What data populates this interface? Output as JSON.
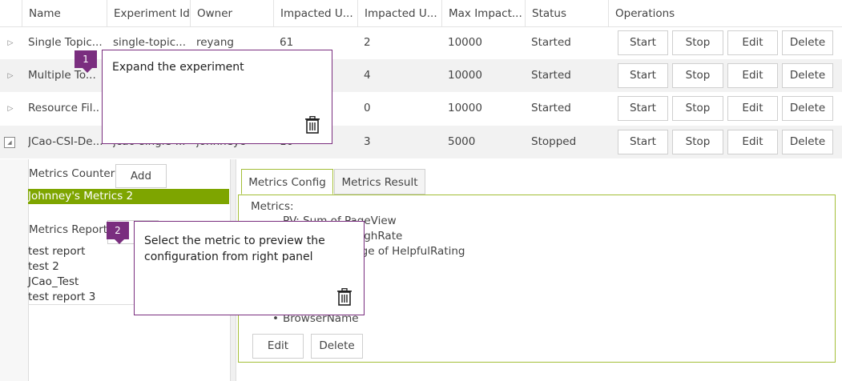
{
  "table": {
    "headers": [
      "Name",
      "Experiment Id",
      "Owner",
      "Impacted U...",
      "Impacted U...",
      "Max Impact...",
      "Status",
      "Operations"
    ],
    "rows": [
      {
        "name": "Single Topic...",
        "id": "single-topic...",
        "owner": "reyang",
        "u1": "61",
        "u2": "2",
        "max": "10000",
        "status": "Started"
      },
      {
        "name": "Multiple To...",
        "id": "",
        "owner": "",
        "u1": "",
        "u2": "4",
        "max": "10000",
        "status": "Started"
      },
      {
        "name": "Resource Fil...",
        "id": "",
        "owner": "",
        "u1": "",
        "u2": "0",
        "max": "10000",
        "status": "Started"
      },
      {
        "name": "JCao-CSI-De...",
        "id": "jcao-single-...",
        "owner": "johnneyc",
        "u1": "10",
        "u2": "3",
        "max": "5000",
        "status": "Stopped"
      }
    ],
    "ops": {
      "start": "Start",
      "stop": "Stop",
      "edit": "Edit",
      "delete": "Delete"
    }
  },
  "left_panel": {
    "counter_label": "Metrics Counter:",
    "add_label": "Add",
    "selected_metric": "Johnney's Metrics 2",
    "report_label": "Metrics Report:",
    "reports": [
      "test report",
      "test 2",
      "JCao_Test",
      "test report 3"
    ]
  },
  "right_panel": {
    "tabs": [
      "Metrics Config",
      "Metrics Result"
    ],
    "metrics_label": "Metrics:",
    "metrics_lines": [
      "PV: Sum of PageView",
      "...of ClickThroughRate",
      "...ge: Percentage of HelpfulRating"
    ],
    "bullet_item": "BrowserName",
    "edit_label": "Edit",
    "delete_label": "Delete"
  },
  "callouts": [
    {
      "number": "1",
      "text": "Expand the experiment"
    },
    {
      "number": "2",
      "text": "Select the metric to preview the configuration from right panel"
    }
  ],
  "colors": {
    "accent_green": "#a3be37",
    "selected_bg": "#7ea500",
    "callout_purple": "#7a2e7f"
  }
}
